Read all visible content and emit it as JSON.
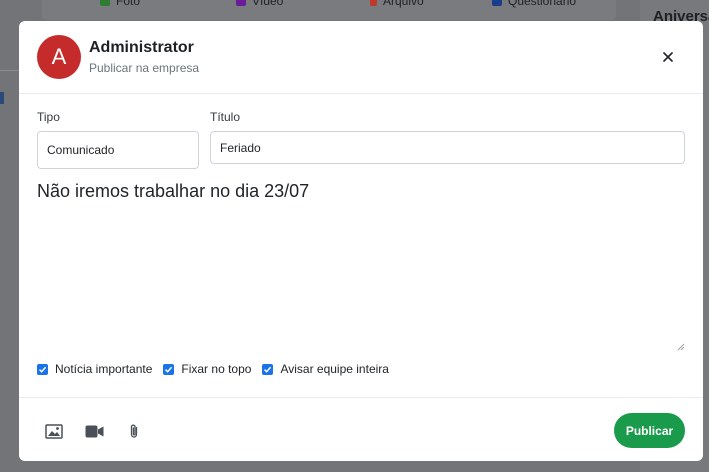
{
  "background": {
    "tabs": [
      {
        "label": "Foto",
        "icon": "image-icon",
        "color": "#2e7d32"
      },
      {
        "label": "Vídeo",
        "icon": "video-icon",
        "color": "#6a1b9a"
      },
      {
        "label": "Arquivo",
        "icon": "paperclip-icon",
        "color": "#c0392b"
      },
      {
        "label": "Questionário",
        "icon": "list-icon",
        "color": "#1a3c8a"
      }
    ],
    "right_title": "Aniversa"
  },
  "header": {
    "avatar_letter": "A",
    "name": "Administrator",
    "subtitle": "Publicar na empresa",
    "avatar_color": "#c62b2b"
  },
  "form": {
    "tipo_label": "Tipo",
    "tipo_value": "Comunicado",
    "titulo_label": "Título",
    "titulo_value": "Feriado",
    "message": "Não iremos trabalhar no dia 23/07"
  },
  "options": [
    {
      "label": "Notícia importante",
      "checked": true
    },
    {
      "label": "Fixar no topo",
      "checked": true
    },
    {
      "label": "Avisar equipe inteira",
      "checked": true
    }
  ],
  "footer": {
    "publish_label": "Publicar",
    "publish_color": "#1a9b4b",
    "attachment_icons": [
      "image-icon",
      "video-camera-icon",
      "paperclip-icon"
    ]
  }
}
